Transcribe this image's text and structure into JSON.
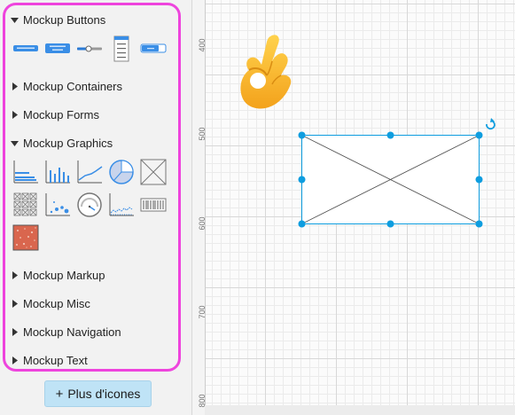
{
  "sidebar": {
    "sections": [
      {
        "label": "Mockup Buttons",
        "expanded": true
      },
      {
        "label": "Mockup Containers",
        "expanded": false
      },
      {
        "label": "Mockup Forms",
        "expanded": false
      },
      {
        "label": "Mockup Graphics",
        "expanded": true
      },
      {
        "label": "Mockup Markup",
        "expanded": false
      },
      {
        "label": "Mockup Misc",
        "expanded": false
      },
      {
        "label": "Mockup Navigation",
        "expanded": false
      },
      {
        "label": "Mockup Text",
        "expanded": false
      }
    ],
    "button_icons": [
      "button-shape-icon",
      "two-line-button-shape-icon",
      "slider-shape-icon",
      "list-box-shape-icon",
      "toggle-button-shape-icon"
    ],
    "graphic_icons": [
      "bar-chart-icon",
      "column-chart-icon",
      "line-chart-icon",
      "pie-chart-icon",
      "image-placeholder-icon",
      "icon-grid-icon",
      "scatter-chart-icon",
      "gauge-icon",
      "area-chart-icon",
      "barcode-icon",
      "texture-image-icon"
    ],
    "more_button": {
      "label": "Plus d'icones"
    },
    "highlight_color": "#ee44dd"
  },
  "canvas": {
    "ruler_labels": [
      "400",
      "500",
      "600",
      "700",
      "800"
    ],
    "emoji": "ok-hand-emoji",
    "selection_color": "#0e9ddf"
  }
}
